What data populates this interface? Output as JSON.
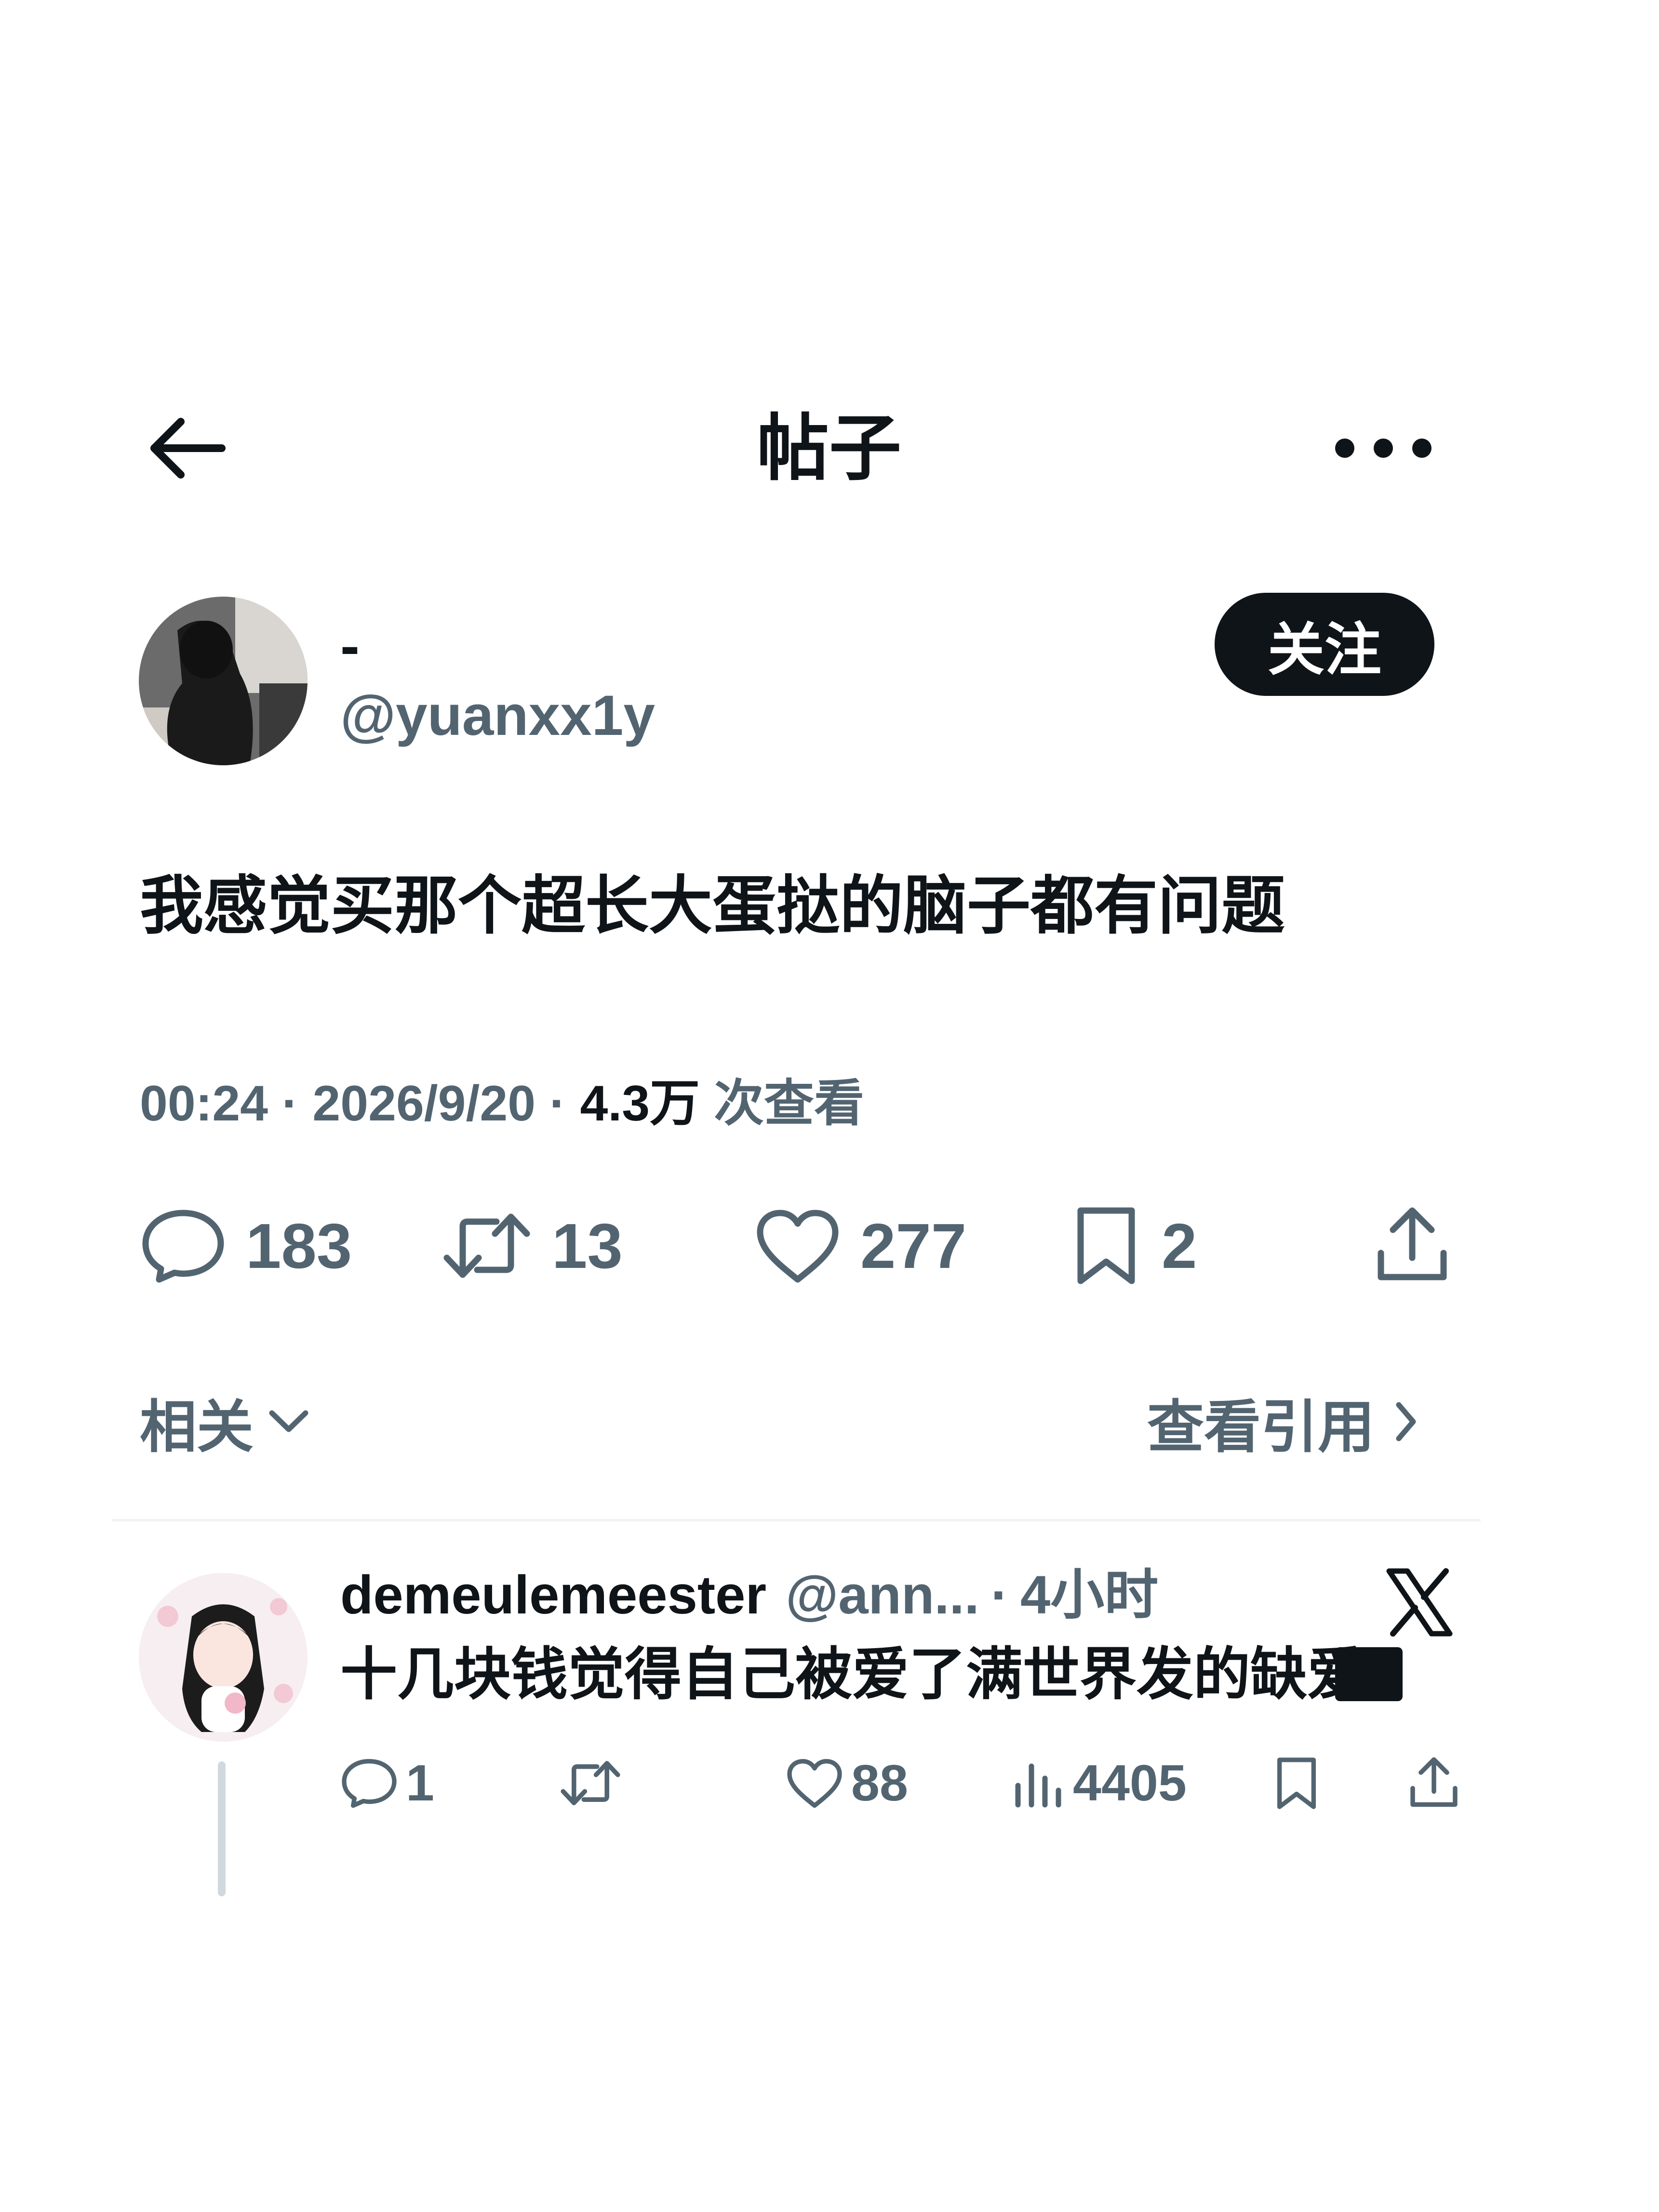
{
  "header": {
    "title": "帖子",
    "back_icon": "arrow-left-icon",
    "more_icon": "more-horizontal-icon"
  },
  "post": {
    "author": {
      "display_name": "-",
      "handle": "@yuanxx1y",
      "follow_label": "关注"
    },
    "text": "我感觉买那个超长大蛋挞的脑子都有问题",
    "meta": {
      "time": "00:24",
      "sep1": " · ",
      "date": "2026/9/20",
      "sep2": " · ",
      "views": "4.3万",
      "views_label": " 次查看"
    },
    "stats": {
      "replies": "183",
      "reposts": "13",
      "likes": "277",
      "bookmarks": "2"
    }
  },
  "related": {
    "label": "相关",
    "quotes_label": "查看引用"
  },
  "reply": {
    "name": "demeulemeester",
    "handle": "@ann...",
    "dot": "·",
    "time": "4小时",
    "text": "十几块钱觉得自己被爱了满世界发的缺爱",
    "stats": {
      "replies": "1",
      "likes": "88",
      "views": "4405"
    }
  },
  "colors": {
    "text": "#0f1419",
    "secondary": "#536471",
    "button_bg": "#0f1419",
    "divider": "#eff3f4"
  }
}
